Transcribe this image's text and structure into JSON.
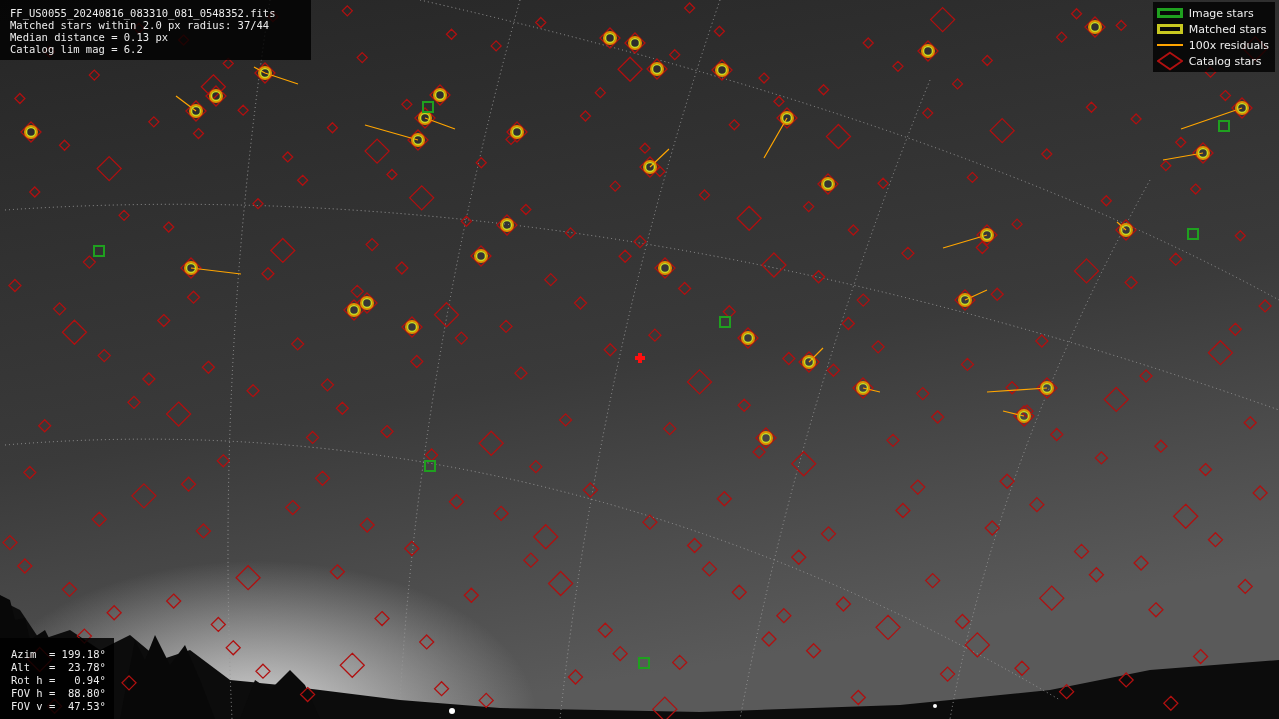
{
  "info_box": {
    "lines": [
      "FF_US0055_20240816_083310_081_0548352.fits",
      "Matched stars within 2.0 px radius: 37/44",
      "Median distance = 0.13 px",
      "Catalog lim mag = 6.2"
    ]
  },
  "legend": {
    "items": [
      {
        "kind": "box",
        "label": "Image stars",
        "color": "#1fa01f"
      },
      {
        "kind": "box",
        "label": "Matched stars",
        "color": "#c8c820"
      },
      {
        "kind": "line",
        "label": "100x residuals",
        "color": "#ffa500"
      },
      {
        "kind": "diamond",
        "label": "Catalog stars",
        "color": "#b01010"
      }
    ]
  },
  "pointing": {
    "lines": [
      "Azim  = 199.18°",
      "Alt   =  23.78°",
      "Rot h =   0.94°",
      "FOV h =  88.80°",
      "FOV v =  47.53°"
    ]
  }
}
